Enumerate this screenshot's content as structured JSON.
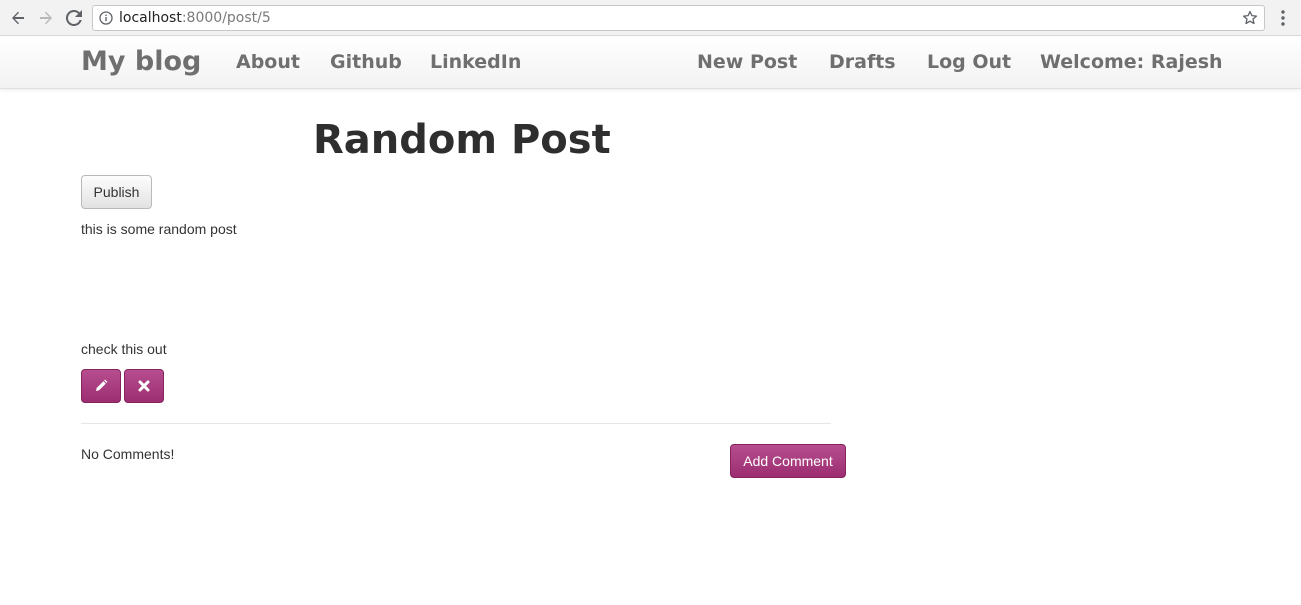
{
  "browser": {
    "url_host": "localhost",
    "url_path": ":8000/post/5"
  },
  "navbar": {
    "brand": "My blog",
    "left_links": [
      "About",
      "Github",
      "LinkedIn"
    ],
    "right_links": [
      "New Post",
      "Drafts",
      "Log Out",
      "Welcome: Rajesh"
    ]
  },
  "post": {
    "title": "Random Post",
    "publish_label": "Publish",
    "body_line_1": "this is some random post",
    "body_line_2": "check this out",
    "edit_icon": "pencil-icon",
    "delete_icon": "remove-icon"
  },
  "comments": {
    "empty_text": "No Comments!",
    "add_label": "Add Comment"
  },
  "colors": {
    "accent": "#a8367b",
    "nav_text": "#6f6f6f",
    "title_text": "#2e2e2e"
  }
}
